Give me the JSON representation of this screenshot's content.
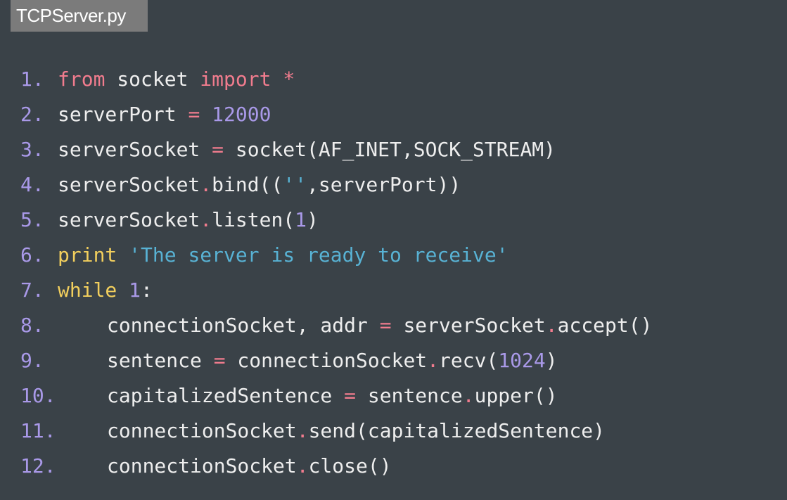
{
  "tab": {
    "title": "TCPServer.py"
  },
  "colors": {
    "background": "#3a4248",
    "tab_background": "#7b7b7b",
    "line_number": "#a999e8",
    "keyword": "#f17c8e",
    "operator": "#f17c8e",
    "number": "#a999e8",
    "builtin": "#f2cf5d",
    "string": "#58b2d4",
    "text": "#eeeeee"
  },
  "code": {
    "lines": [
      {
        "number": "1.",
        "indent": false,
        "tokens": [
          {
            "t": "kw",
            "v": "from"
          },
          {
            "t": "name",
            "v": " socket "
          },
          {
            "t": "kw",
            "v": "import"
          },
          {
            "t": "name",
            "v": " "
          },
          {
            "t": "op",
            "v": "*"
          }
        ]
      },
      {
        "number": "2.",
        "indent": false,
        "tokens": [
          {
            "t": "name",
            "v": "serverPort "
          },
          {
            "t": "op",
            "v": "="
          },
          {
            "t": "name",
            "v": " "
          },
          {
            "t": "num",
            "v": "12000"
          }
        ]
      },
      {
        "number": "3.",
        "indent": false,
        "tokens": [
          {
            "t": "name",
            "v": "serverSocket "
          },
          {
            "t": "op",
            "v": "="
          },
          {
            "t": "name",
            "v": " socket(AF_INET,SOCK_STREAM)"
          }
        ]
      },
      {
        "number": "4.",
        "indent": false,
        "tokens": [
          {
            "t": "name",
            "v": "serverSocket"
          },
          {
            "t": "op",
            "v": "."
          },
          {
            "t": "name",
            "v": "bind(("
          },
          {
            "t": "str",
            "v": "''"
          },
          {
            "t": "name",
            "v": ",serverPort))"
          }
        ]
      },
      {
        "number": "5.",
        "indent": false,
        "tokens": [
          {
            "t": "name",
            "v": "serverSocket"
          },
          {
            "t": "op",
            "v": "."
          },
          {
            "t": "name",
            "v": "listen("
          },
          {
            "t": "num",
            "v": "1"
          },
          {
            "t": "name",
            "v": ")"
          }
        ]
      },
      {
        "number": "6.",
        "indent": false,
        "tokens": [
          {
            "t": "builtin",
            "v": "print"
          },
          {
            "t": "name",
            "v": " "
          },
          {
            "t": "str",
            "v": "'The server is ready to receive'"
          }
        ]
      },
      {
        "number": "7.",
        "indent": false,
        "tokens": [
          {
            "t": "builtin",
            "v": "while"
          },
          {
            "t": "name",
            "v": " "
          },
          {
            "t": "num",
            "v": "1"
          },
          {
            "t": "name",
            "v": ":"
          }
        ]
      },
      {
        "number": "8.",
        "indent": true,
        "tokens": [
          {
            "t": "name",
            "v": "connectionSocket, addr "
          },
          {
            "t": "op",
            "v": "="
          },
          {
            "t": "name",
            "v": " serverSocket"
          },
          {
            "t": "op",
            "v": "."
          },
          {
            "t": "name",
            "v": "accept()"
          }
        ]
      },
      {
        "number": "9.",
        "indent": true,
        "tokens": [
          {
            "t": "name",
            "v": "sentence "
          },
          {
            "t": "op",
            "v": "="
          },
          {
            "t": "name",
            "v": " connectionSocket"
          },
          {
            "t": "op",
            "v": "."
          },
          {
            "t": "name",
            "v": "recv("
          },
          {
            "t": "num",
            "v": "1024"
          },
          {
            "t": "name",
            "v": ")"
          }
        ]
      },
      {
        "number": "10.",
        "indent": true,
        "tokens": [
          {
            "t": "name",
            "v": "capitalizedSentence "
          },
          {
            "t": "op",
            "v": "="
          },
          {
            "t": "name",
            "v": " sentence"
          },
          {
            "t": "op",
            "v": "."
          },
          {
            "t": "name",
            "v": "upper()"
          }
        ]
      },
      {
        "number": "11.",
        "indent": true,
        "tokens": [
          {
            "t": "name",
            "v": "connectionSocket"
          },
          {
            "t": "op",
            "v": "."
          },
          {
            "t": "name",
            "v": "send(capitalizedSentence)"
          }
        ]
      },
      {
        "number": "12.",
        "indent": true,
        "tokens": [
          {
            "t": "name",
            "v": "connectionSocket"
          },
          {
            "t": "op",
            "v": "."
          },
          {
            "t": "name",
            "v": "close()"
          }
        ]
      }
    ]
  }
}
